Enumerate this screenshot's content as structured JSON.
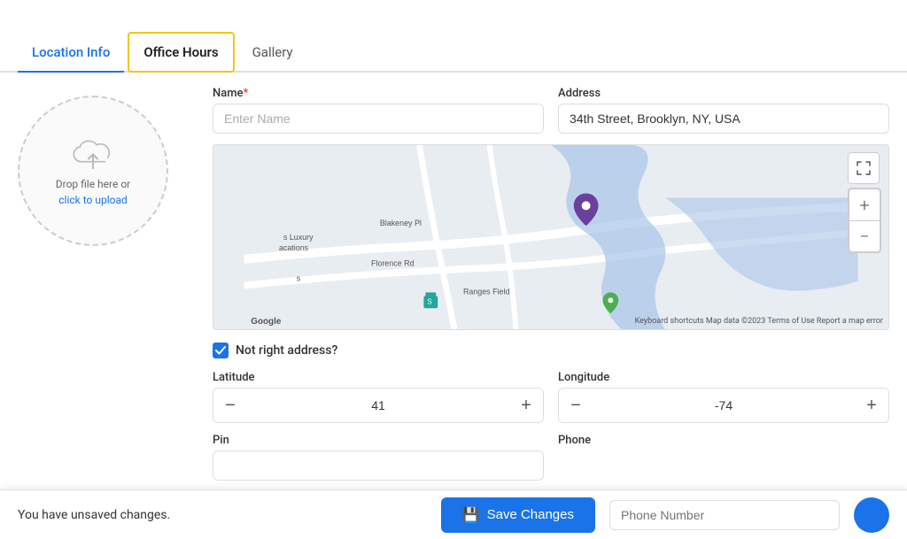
{
  "tabs": [
    {
      "id": "location-info",
      "label": "Location Info",
      "state": "active-blue"
    },
    {
      "id": "office-hours",
      "label": "Office Hours",
      "state": "active-yellow"
    },
    {
      "id": "gallery",
      "label": "Gallery",
      "state": "inactive"
    }
  ],
  "upload": {
    "drop_text": "Drop file here or",
    "link_text": "click to upload"
  },
  "form": {
    "name_label": "Name",
    "name_placeholder": "Enter Name",
    "address_label": "Address",
    "address_value": "34th Street, Brooklyn, NY, USA"
  },
  "map": {
    "fullscreen_icon": "⤢",
    "zoom_in_label": "+",
    "zoom_out_label": "−",
    "watermark": "Google",
    "attribution": "Keyboard shortcuts   Map data ©2023   Terms of Use   Report a map error",
    "labels": [
      "s Luxury",
      "acations",
      "Blakeney Pl",
      "Florence Rd",
      "s",
      "Ranges Field"
    ]
  },
  "address_check": {
    "label": "Not right address?"
  },
  "latitude": {
    "label": "Latitude",
    "value": "41",
    "minus_label": "−",
    "plus_label": "+"
  },
  "longitude": {
    "label": "Longitude",
    "value": "-74",
    "minus_label": "−",
    "plus_label": "+"
  },
  "pin": {
    "label": "Pin"
  },
  "phone": {
    "label": "Phone"
  },
  "notification": {
    "unsaved_text": "You have unsaved changes.",
    "save_label": "Save Changes",
    "phone_placeholder": "Phone Number"
  },
  "colors": {
    "accent": "#1a73e8",
    "tab_highlight": "#f5c518"
  }
}
